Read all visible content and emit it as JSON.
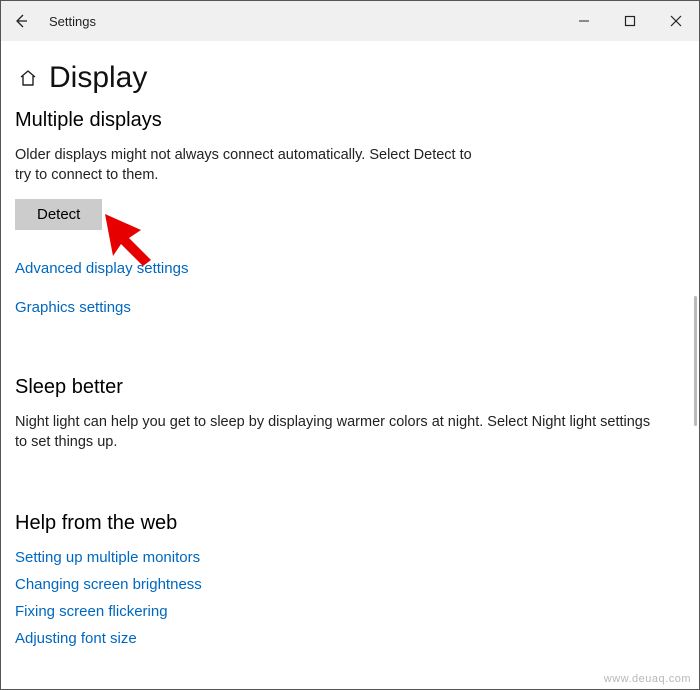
{
  "titlebar": {
    "title": "Settings"
  },
  "header": {
    "page_title": "Display"
  },
  "sections": {
    "multiple_displays": {
      "heading": "Multiple displays",
      "description": "Older displays might not always connect automatically. Select Detect to try to connect to them.",
      "detect_button": "Detect",
      "advanced_link": "Advanced display settings",
      "graphics_link": "Graphics settings"
    },
    "sleep_better": {
      "heading": "Sleep better",
      "description": "Night light can help you get to sleep by displaying warmer colors at night. Select Night light settings to set things up."
    },
    "help_web": {
      "heading": "Help from the web",
      "links": [
        "Setting up multiple monitors",
        "Changing screen brightness",
        "Fixing screen flickering",
        "Adjusting font size"
      ]
    }
  },
  "watermark": "www.deuaq.com"
}
